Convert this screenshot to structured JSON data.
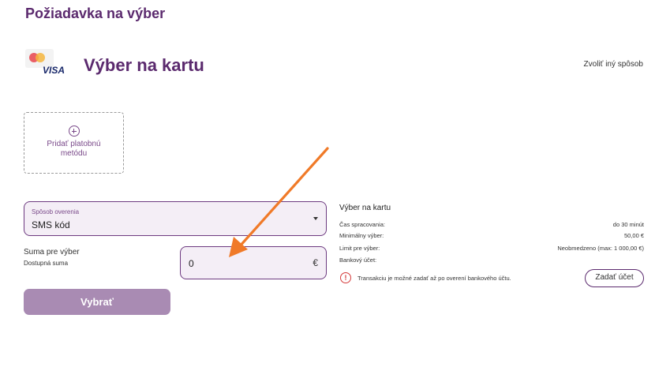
{
  "header": {
    "title": "Požiadavka na výber"
  },
  "method": {
    "logo_text": "VISA",
    "logo_icon": "mastercard-visa-logo",
    "title": "Výber na kartu",
    "change_link": "Zvoliť iný spôsob"
  },
  "add_card": {
    "icon": "plus-circle-icon",
    "label": "Pridať platobnú metódu"
  },
  "verification": {
    "label": "Spôsob overenia",
    "value": "SMS kód",
    "icon": "chevron-down-icon"
  },
  "amount": {
    "label": "Suma pre výber",
    "available_label": "Dostupná suma",
    "value": "0",
    "currency": "€"
  },
  "submit": {
    "label": "Vybrať"
  },
  "info": {
    "title": "Výber na kartu",
    "rows": [
      {
        "key": "Čas spracovania:",
        "value": "do 30 minút"
      },
      {
        "key": "Minimálny výber:",
        "value": "50,00 €"
      },
      {
        "key": "Limit pre výber:",
        "value": "Neobmedzeno (max: 1 000,00 €)"
      },
      {
        "key": "Bankový účet:",
        "value": ""
      }
    ],
    "warning_icon": "exclamation-circle-icon",
    "warning": "Transakciu je možné zadať až po overení bankového účtu.",
    "enter_account_label": "Zadať účet"
  },
  "annotation": {
    "icon": "orange-arrow-icon",
    "color": "#f07a28"
  },
  "colors": {
    "brand": "#5b2a6e",
    "button_disabled": "#a98bb3",
    "warning": "#d43a3a"
  }
}
